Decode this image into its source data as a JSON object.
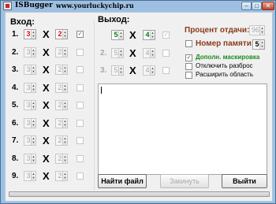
{
  "window": {
    "title": "ISBugger",
    "url": "www.yourluckychip.ru",
    "min_glyph": "–",
    "max_glyph": "□",
    "close_glyph": "✕"
  },
  "input": {
    "label": "Вход:",
    "rows": [
      {
        "num": "1.",
        "a": "3",
        "b": "2",
        "checked": true
      },
      {
        "num": "2.",
        "a": "3",
        "b": "2",
        "checked": false
      },
      {
        "num": "3.",
        "a": "3",
        "b": "2",
        "checked": false
      },
      {
        "num": "4.",
        "a": "3",
        "b": "2",
        "checked": false
      },
      {
        "num": "5.",
        "a": "3",
        "b": "2",
        "checked": false
      },
      {
        "num": "6.",
        "a": "3",
        "b": "2",
        "checked": false
      },
      {
        "num": "7.",
        "a": "3",
        "b": "2",
        "checked": false
      },
      {
        "num": "8.",
        "a": "3",
        "b": "2",
        "checked": false
      },
      {
        "num": "9.",
        "a": "3",
        "b": "2",
        "checked": false
      }
    ],
    "times_glyph": "X"
  },
  "output": {
    "label": "Выход:",
    "rows": [
      {
        "num": "1.",
        "a": "5",
        "b": "4",
        "checked": true
      },
      {
        "num": "2.",
        "a": "5",
        "b": "4",
        "checked": false
      },
      {
        "num": "3.",
        "a": "5",
        "b": "4",
        "checked": false
      }
    ]
  },
  "settings": {
    "payout_label": "Процент отдачи:",
    "payout_value": "96",
    "memory_label": "Номер памяти:",
    "memory_value": "5",
    "memory_checked": false,
    "options": [
      {
        "label": "Дополн. маскировка",
        "checked": true
      },
      {
        "label": "Отключить разброс",
        "checked": false
      },
      {
        "label": "Расширить область",
        "checked": false
      }
    ]
  },
  "log": {
    "text": ""
  },
  "buttons": {
    "find_file": "Найти файл",
    "inject": "Закинуть",
    "exit": "Выйти"
  },
  "progress": {
    "value": 0
  },
  "colors": {
    "window_frame": "#9dc0e2",
    "accent_brown": "#8b3a1a",
    "accent_green": "#1a8a1a",
    "value_red": "#d01010",
    "value_green": "#0a7a0a"
  }
}
